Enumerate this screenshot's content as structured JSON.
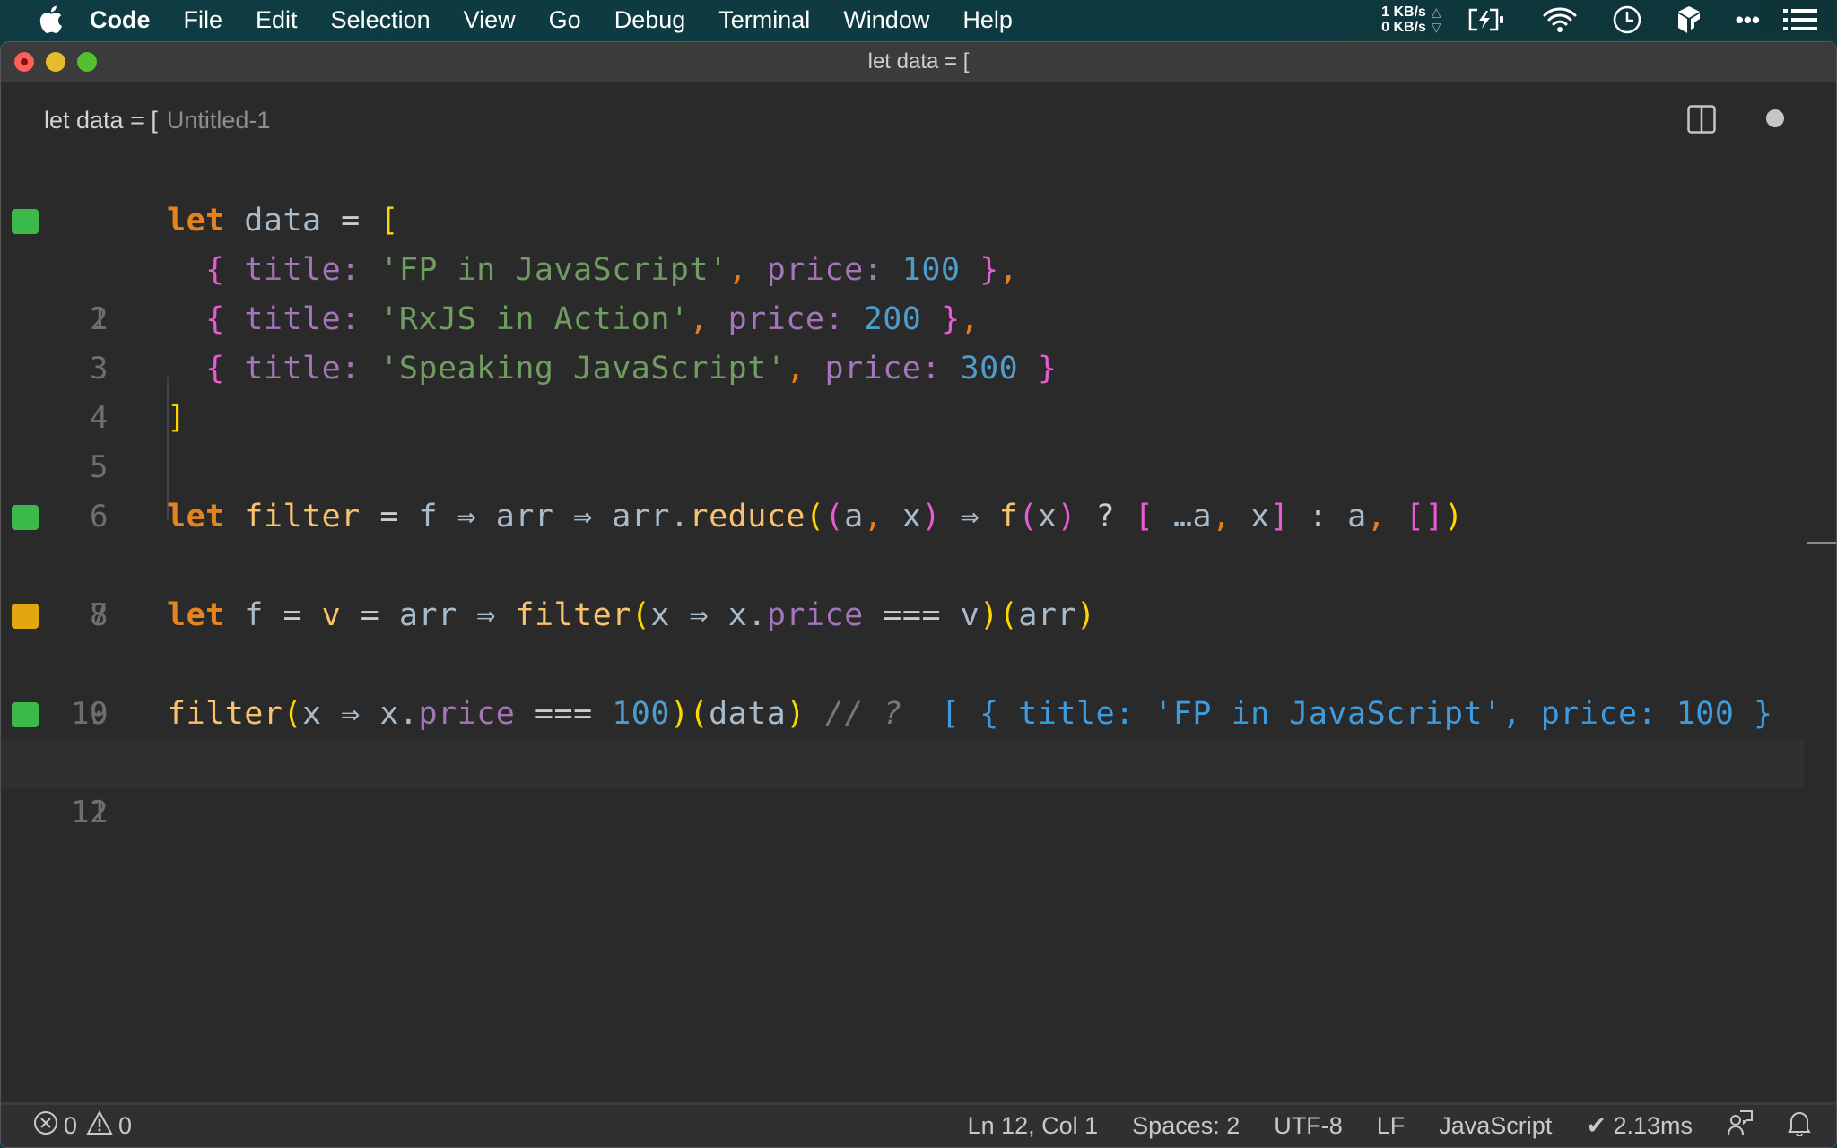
{
  "menubar": {
    "app_name": "Code",
    "items": [
      "File",
      "Edit",
      "Selection",
      "View",
      "Go",
      "Debug",
      "Terminal",
      "Window",
      "Help"
    ],
    "net_up": "1 KB/s",
    "net_down": "0 KB/s",
    "tray_icons": [
      "battery-charging-icon",
      "wifi-icon",
      "clock-icon",
      "dropbox-icon",
      "more-icon",
      "list-icon"
    ]
  },
  "window": {
    "title": "let data = ["
  },
  "tab": {
    "label": "let data = [",
    "description": "Untitled-1",
    "dirty": true
  },
  "editor": {
    "lines": [
      {
        "number": "1",
        "marker": "green"
      },
      {
        "number": "2",
        "marker": null
      },
      {
        "number": "3",
        "marker": null
      },
      {
        "number": "4",
        "marker": null
      },
      {
        "number": "5",
        "marker": null
      },
      {
        "number": "6",
        "marker": null
      },
      {
        "number": "7",
        "marker": "green"
      },
      {
        "number": "8",
        "marker": null
      },
      {
        "number": "9",
        "marker": "orange"
      },
      {
        "number": "10",
        "marker": null
      },
      {
        "number": "11",
        "marker": "green"
      },
      {
        "number": "12",
        "marker": null
      }
    ],
    "code": {
      "l1": {
        "kw": "let",
        "name": "data",
        "eq": "=",
        "open": "["
      },
      "l2": {
        "open": "{",
        "key": "title:",
        "str": "'FP in JavaScript'",
        "comma": ",",
        "key2": "price:",
        "num": "100",
        "close": "}",
        "comma2": ","
      },
      "l3": {
        "open": "{",
        "key": "title:",
        "str": "'RxJS in Action'",
        "comma": ",",
        "key2": "price:",
        "num": "200",
        "close": "}",
        "comma2": ","
      },
      "l4": {
        "open": "{",
        "key": "title:",
        "str": "'Speaking JavaScript'",
        "comma": ",",
        "key2": "price:",
        "num": "300",
        "close": "}"
      },
      "l5": {
        "close": "]"
      },
      "l7": {
        "kw": "let",
        "name": "filter",
        "eq": "=",
        "f": "f",
        "arrow": "⇒",
        "arr": "arr",
        "arrdot": "arr.",
        "reduce": "reduce",
        "p1": "(",
        "p2": "(",
        "a": "a",
        "comma": ",",
        "x": "x",
        "p2c": ")",
        "fcall": "f",
        "p3": "(",
        "p3c": ")",
        "q": "?",
        "b1": "[",
        "spread": "…a",
        "b1c": "]",
        "colon": ":",
        "empty": "[]",
        "p1c": ")"
      },
      "l9": {
        "kw": "let",
        "f": "f",
        "eq": "=",
        "v": "v",
        "arr": "arr",
        "arrow": "⇒",
        "filter": "filter",
        "p1": "(",
        "x": "x",
        "xdot": "x.",
        "price": "price",
        "eqq": "===",
        "p1c": ")",
        "p2": "(",
        "p2c": ")"
      },
      "l11": {
        "filter": "filter",
        "p1": "(",
        "x": "x",
        "arrow": "⇒",
        "xdot": "x.",
        "price": "price",
        "eqq": "===",
        "num": "100",
        "p1c": ")",
        "p2": "(",
        "data": "data",
        "p2c": ")",
        "comment": "// ?",
        "result": "[ { title: 'FP in JavaScript', price: 100 }"
      }
    },
    "current_line": 12
  },
  "statusbar": {
    "errors": "0",
    "warnings": "0",
    "position": "Ln 12, Col 1",
    "indent": "Spaces: 2",
    "encoding": "UTF-8",
    "eol": "LF",
    "language": "JavaScript",
    "timing": "✔ 2.13ms"
  },
  "colors": {
    "keyword": "#e38421",
    "string": "#6f9c60",
    "number": "#4d9ccc",
    "property": "#a475b8",
    "function": "#f8c36b",
    "marker_green": "#3cb94b",
    "marker_orange": "#e2a610"
  }
}
